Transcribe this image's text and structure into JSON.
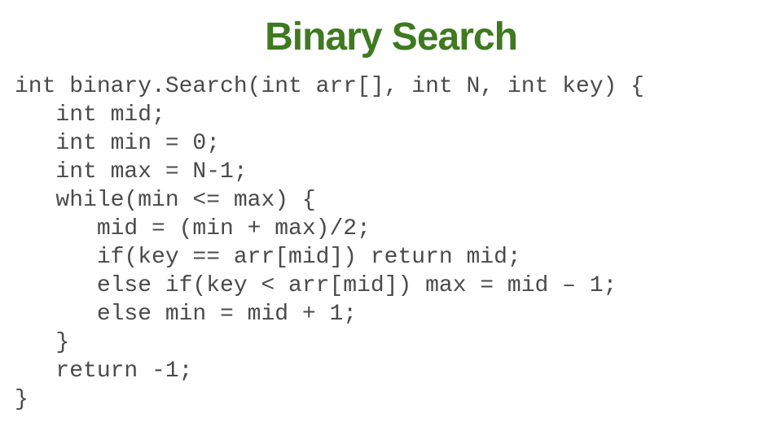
{
  "title": "Binary Search",
  "code": {
    "l0": "int binary.Search(int arr[], int N, int key) {",
    "l1": "   int mid;",
    "l2": "   int min = 0;",
    "l3": "   int max = N-1;",
    "l4": "   while(min <= max) {",
    "l5": "      mid = (min + max)/2;",
    "l6": "      if(key == arr[mid]) return mid;",
    "l7": "      else if(key < arr[mid]) max = mid – 1;",
    "l8": "      else min = mid + 1;",
    "l9": "   }",
    "l10": "   return -1;",
    "l11": "}"
  }
}
